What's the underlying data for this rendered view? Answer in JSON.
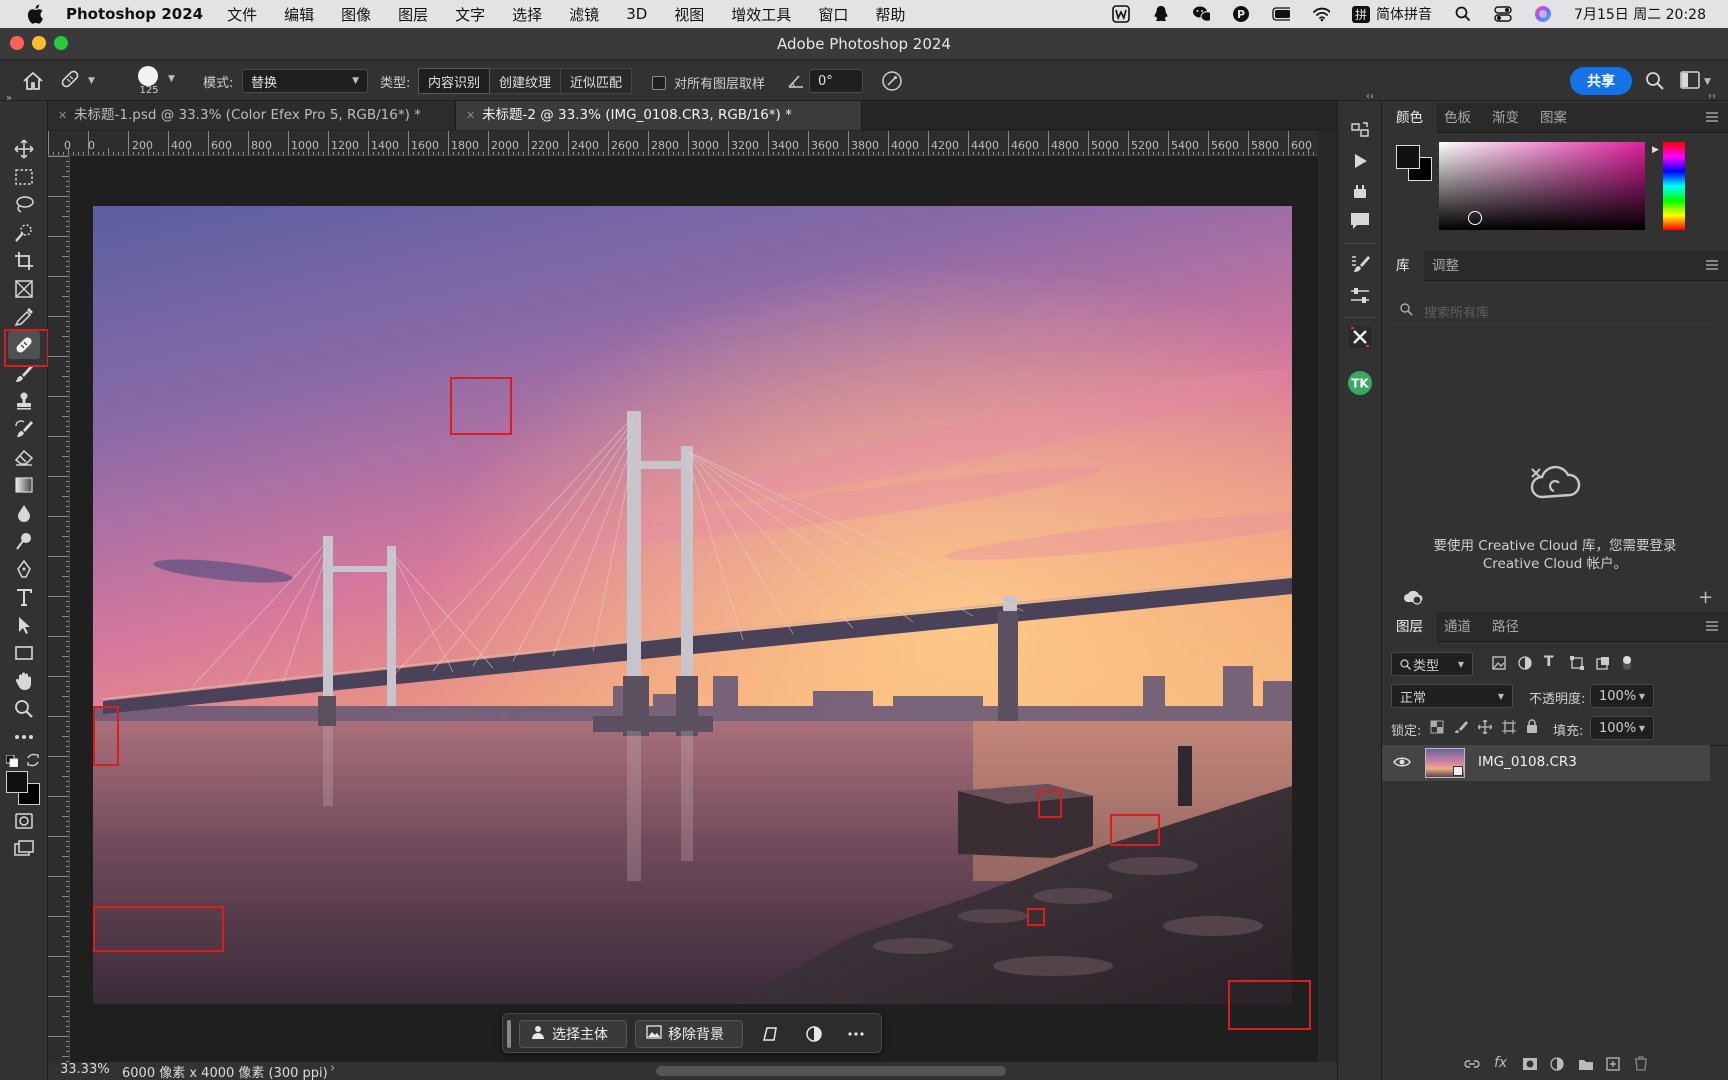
{
  "menubar": {
    "app_name": "Photoshop 2024",
    "items": [
      "文件",
      "编辑",
      "图像",
      "图层",
      "文字",
      "选择",
      "滤镜",
      "3D",
      "视图",
      "增效工具",
      "窗口",
      "帮助"
    ],
    "input_method": "简体拼音",
    "input_badge": "拼",
    "datetime": "7月15日 周二 20:28"
  },
  "window": {
    "title": "Adobe Photoshop 2024"
  },
  "options": {
    "brush_size": "125",
    "mode_label": "模式:",
    "mode_value": "替换",
    "type_label": "类型:",
    "type_options": [
      "内容识别",
      "创建纹理",
      "近似匹配"
    ],
    "sample_all_label": "对所有图层取样",
    "angle_value": "0°",
    "share_label": "共享"
  },
  "tabs": [
    {
      "label": "未标题-1.psd @ 33.3% (Color Efex Pro 5, RGB/16*) *",
      "active": false
    },
    {
      "label": "未标题-2 @ 33.3% (IMG_0108.CR3, RGB/16*) *",
      "active": true
    }
  ],
  "ruler": {
    "top_labels": [
      "0",
      "0",
      "200",
      "400",
      "600",
      "800",
      "1000",
      "1200",
      "1400",
      "1600",
      "1800",
      "2000",
      "2200",
      "2400",
      "2600",
      "2800",
      "3000",
      "3200",
      "3400",
      "3600",
      "3800",
      "4000",
      "4200",
      "4400",
      "4600",
      "4800",
      "5000",
      "5200",
      "5400",
      "5600",
      "5800",
      "600"
    ]
  },
  "context_bar": {
    "select_subject": "选择主体",
    "remove_background": "移除背景"
  },
  "status": {
    "zoom": "33.33%",
    "doc_info": "6000 像素 x 4000 像素 (300 ppi)"
  },
  "color_panel": {
    "tabs": [
      "颜色",
      "色板",
      "渐变",
      "图案"
    ],
    "foreground": "#111111",
    "background": "#000000"
  },
  "library_panel": {
    "tabs": [
      "库",
      "调整"
    ],
    "search_placeholder": "搜索所有库",
    "message": "要使用 Creative Cloud 库，您需要登录 Creative Cloud 帐户。"
  },
  "layers_panel": {
    "tabs": [
      "图层",
      "通道",
      "路径"
    ],
    "filter_label": "类型",
    "blend_mode": "正常",
    "opacity_label": "不透明度:",
    "opacity_value": "100%",
    "lock_label": "锁定:",
    "fill_label": "填充:",
    "fill_value": "100%",
    "layers": [
      {
        "name": "IMG_0108.CR3",
        "visible": true
      }
    ]
  },
  "colors": {
    "accent": "#1473e6",
    "annotation_red": "#d81e1e"
  }
}
